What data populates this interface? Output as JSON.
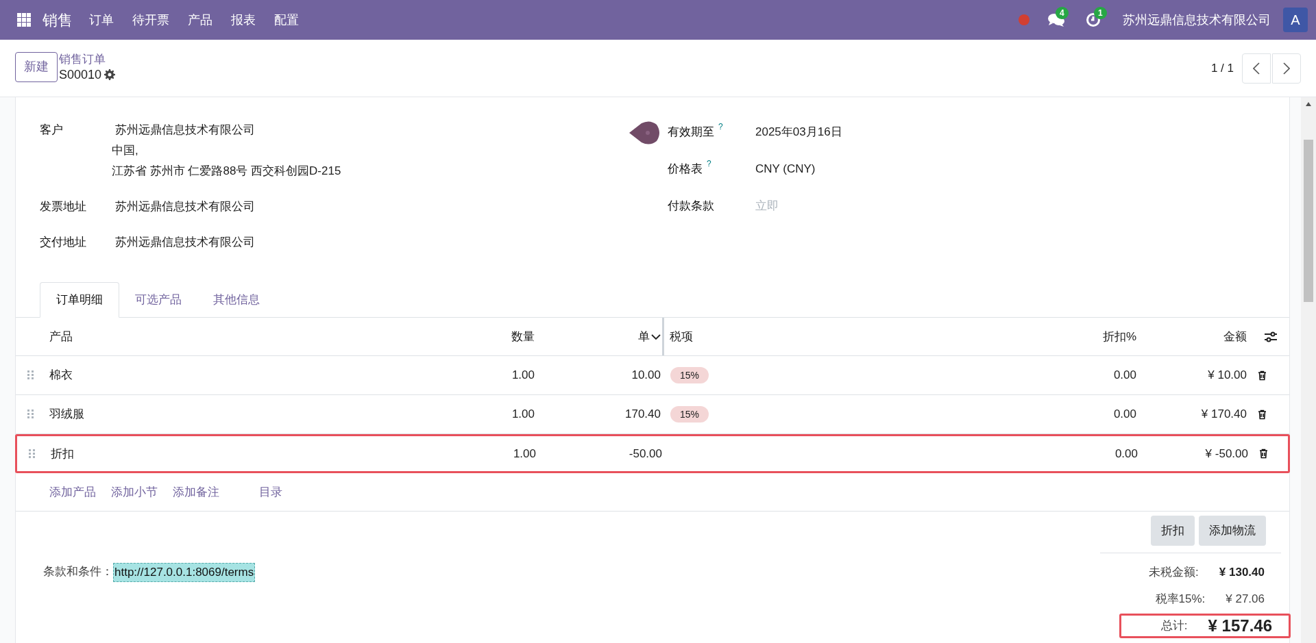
{
  "navbar": {
    "app": "销售",
    "menu": [
      "订单",
      "待开票",
      "产品",
      "报表",
      "配置"
    ],
    "messages_count": "4",
    "activities_count": "1",
    "company": "苏州远鼎信息技术有限公司",
    "avatar": "A"
  },
  "control_panel": {
    "new_button": "新建",
    "breadcrumb": "销售订单",
    "record": "S00010",
    "pager": "1 / 1"
  },
  "form": {
    "left_fields": [
      {
        "label": "客户",
        "lines": [
          "苏州远鼎信息技术有限公司",
          "中国,",
          "江苏省 苏州市 仁爱路88号 西交科创园D-215"
        ]
      },
      {
        "label": "发票地址",
        "lines": [
          "苏州远鼎信息技术有限公司"
        ]
      },
      {
        "label": "交付地址",
        "lines": [
          "苏州远鼎信息技术有限公司"
        ]
      }
    ],
    "right_fields": [
      {
        "label": "有效期至",
        "help": "?",
        "value": "2025年03月16日"
      },
      {
        "label": "价格表",
        "help": "?",
        "value": "CNY (CNY)"
      },
      {
        "label": "付款条款",
        "placeholder": "立即"
      }
    ]
  },
  "tabs": [
    {
      "label": "订单明细",
      "selected": true
    },
    {
      "label": "可选产品",
      "selected": false
    },
    {
      "label": "其他信息",
      "selected": false
    }
  ],
  "table": {
    "columns": [
      "产品",
      "数量",
      "单",
      "税项",
      "折扣%",
      "金额"
    ],
    "rows": [
      {
        "product": "棉衣",
        "quantity": "1.00",
        "unit_price": "10.00",
        "taxes": [
          "15%"
        ],
        "discount": "0.00",
        "amount": "¥ 10.00",
        "highlighted": false
      },
      {
        "product": "羽绒服",
        "quantity": "1.00",
        "unit_price": "170.40",
        "taxes": [
          "15%"
        ],
        "discount": "0.00",
        "amount": "¥ 170.40",
        "highlighted": false
      },
      {
        "product": "折扣",
        "quantity": "1.00",
        "unit_price": "-50.00",
        "taxes": [],
        "discount": "0.00",
        "amount": "¥ -50.00",
        "highlighted": true
      }
    ],
    "add_links": [
      "添加产品",
      "添加小节",
      "添加备注",
      "目录"
    ]
  },
  "buttons": [
    "折扣",
    "添加物流"
  ],
  "terms": {
    "label": "条款和条件：",
    "value": "http://127.0.0.1:8069/terms"
  },
  "totals": [
    {
      "kind": "subtotal",
      "label": "未税金额:",
      "value": "¥ 130.40",
      "highlighted": false
    },
    {
      "kind": "tax",
      "label": "税率15%:",
      "value": "¥ 27.06",
      "highlighted": false
    },
    {
      "kind": "total",
      "label": "总计:",
      "value": "¥ 157.46",
      "highlighted": true
    }
  ]
}
